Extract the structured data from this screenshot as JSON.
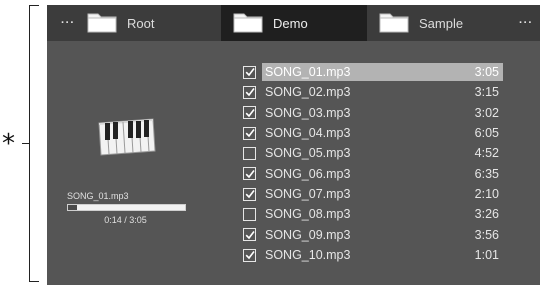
{
  "annotation": {
    "marker": "*"
  },
  "tabs": [
    {
      "label": "Root",
      "active": false
    },
    {
      "label": "Demo",
      "active": true
    },
    {
      "label": "Sample",
      "active": false
    }
  ],
  "tab_overflow": {
    "left": "···",
    "right": "···"
  },
  "player": {
    "icon": "piano-keyboard-icon",
    "current_file": "SONG_01.mp3",
    "elapsed": "0:14",
    "duration": "3:05",
    "time_text": "0:14 / 3:05",
    "progress_fraction": 0.076
  },
  "songs": [
    {
      "name": "SONG_01.mp3",
      "duration": "3:05",
      "checked": true,
      "selected": true
    },
    {
      "name": "SONG_02.mp3",
      "duration": "3:15",
      "checked": true,
      "selected": false
    },
    {
      "name": "SONG_03.mp3",
      "duration": "3:02",
      "checked": true,
      "selected": false
    },
    {
      "name": "SONG_04.mp3",
      "duration": "6:05",
      "checked": true,
      "selected": false
    },
    {
      "name": "SONG_05.mp3",
      "duration": "4:52",
      "checked": false,
      "selected": false
    },
    {
      "name": "SONG_06.mp3",
      "duration": "6:35",
      "checked": true,
      "selected": false
    },
    {
      "name": "SONG_07.mp3",
      "duration": "2:10",
      "checked": true,
      "selected": false
    },
    {
      "name": "SONG_08.mp3",
      "duration": "3:26",
      "checked": false,
      "selected": false
    },
    {
      "name": "SONG_09.mp3",
      "duration": "3:56",
      "checked": true,
      "selected": false
    },
    {
      "name": "SONG_10.mp3",
      "duration": "1:01",
      "checked": true,
      "selected": false
    }
  ],
  "colors": {
    "panel_bg": "#555555",
    "tabbar_bg": "#3c3c3c",
    "active_tab_bg": "#1f1f1f",
    "selected_row_bg": "#b3b3b3"
  }
}
